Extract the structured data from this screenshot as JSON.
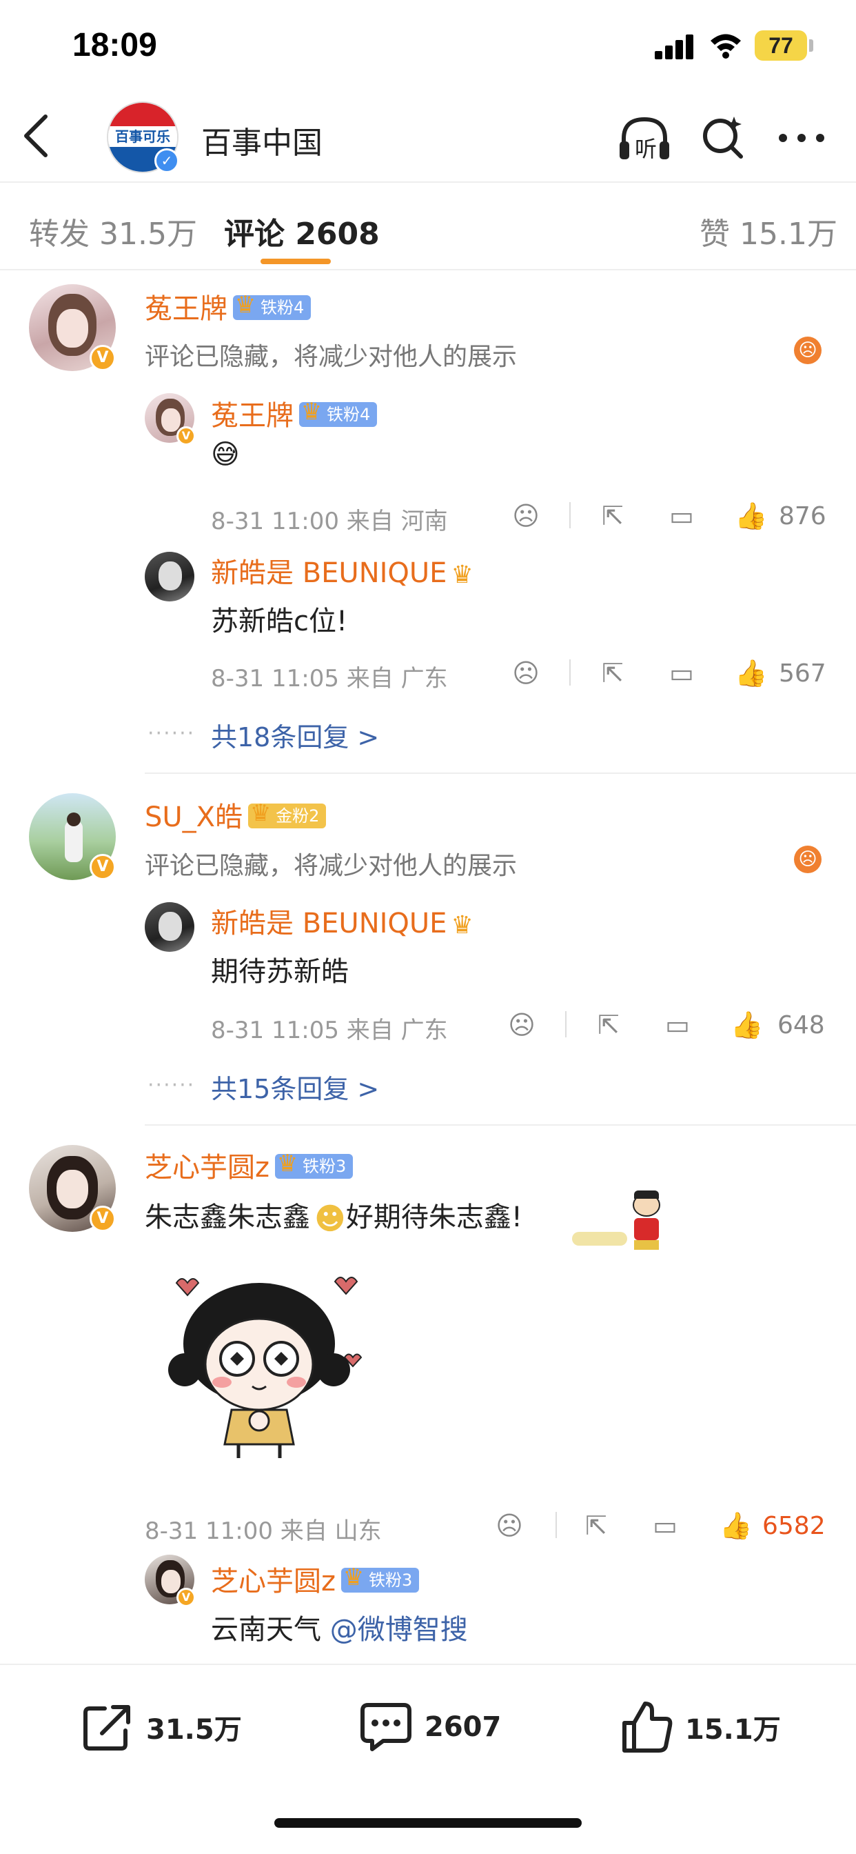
{
  "status_bar": {
    "time": "18:09",
    "battery": "77"
  },
  "header": {
    "account_name": "百事中国",
    "logo_text": "百事可乐",
    "listen_label": "听"
  },
  "tabs": [
    {
      "label": "转发 31.5万"
    },
    {
      "label": "评论 2608"
    },
    {
      "label": "赞 15.1万"
    }
  ],
  "comments": [
    {
      "user": "菟王牌",
      "fan_badge": "铁粉4",
      "text": "评论已隐藏，将减少对他人的展示",
      "replies": [
        {
          "user": "菟王牌",
          "fan_badge": "铁粉4",
          "text": "😅",
          "time": "8-31 11:00",
          "location": "来自 河南",
          "likes": "876"
        },
        {
          "user": "新皓是 BEUNIQUE",
          "text": "苏新皓c位!",
          "time": "8-31 11:05",
          "location": "来自 广东",
          "likes": "567"
        }
      ],
      "more_replies": "共18条回复 >"
    },
    {
      "user": "SU_X皓",
      "fan_badge": "金粉2",
      "text": "评论已隐藏，将减少对他人的展示",
      "replies": [
        {
          "user": "新皓是 BEUNIQUE",
          "text": "期待苏新皓",
          "time": "8-31 11:05",
          "location": "来自 广东",
          "likes": "648"
        }
      ],
      "more_replies": "共15条回复 >"
    },
    {
      "user": "芝心芋圆z",
      "fan_badge": "铁粉3",
      "text_a": "朱志鑫朱志鑫",
      "text_b": "好期待朱志鑫!",
      "time": "8-31 11:00",
      "location": "来自 山东",
      "likes": "6582",
      "replies": [
        {
          "user": "芝心芋圆z",
          "fan_badge": "铁粉3",
          "text_a": "云南天气 ",
          "mention": "@微博智搜"
        }
      ]
    }
  ],
  "bottom_bar": {
    "reposts": "31.5万",
    "comments": "2607",
    "likes": "15.1万"
  },
  "icons": [
    "back-icon",
    "headphones-icon",
    "search-icon",
    "more-icon",
    "dislike-icon",
    "share-icon",
    "comment-icon",
    "like-icon",
    "angry-icon",
    "verified-icon"
  ],
  "colors": {
    "accent": "#f49628",
    "username": "#e86d1c",
    "link": "#3d63a8",
    "liked": "#e8541c"
  }
}
